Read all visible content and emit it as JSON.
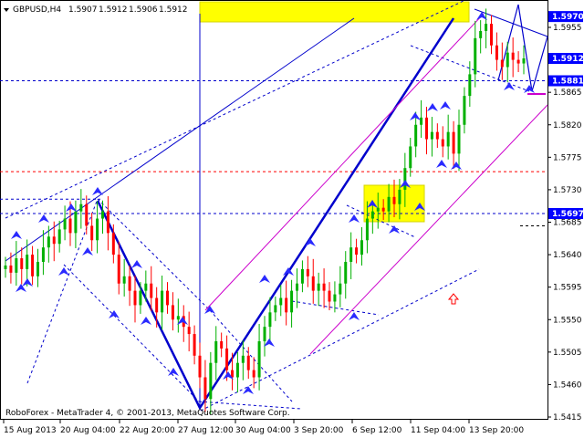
{
  "header": {
    "symbol": "GBPUSD,H4",
    "open": "1.5907",
    "high": "1.5912",
    "low": "1.5906",
    "close": "1.5912"
  },
  "copyright": "RoboForex - MetaTrader 4, © 2001-2013, MetaQuotes Software Corp.",
  "colors": {
    "bull": "#00b000",
    "bear": "#ff0000",
    "trend": "#0000cc",
    "channel": "#cc00cc",
    "level_red": "#ff0000",
    "highlight": "#ffff00",
    "price_box": "#0000ff",
    "fractal": "#2a2aff"
  },
  "chart_data": {
    "type": "candlestick",
    "ylim": [
      1.5405,
      1.599
    ],
    "y_ticks": [
      "1.5955",
      "1.5910",
      "1.5865",
      "1.5820",
      "1.5775",
      "1.5730",
      "1.5685",
      "1.5640",
      "1.5595",
      "1.5550",
      "1.5505",
      "1.5460",
      "1.5415"
    ],
    "x_labels": [
      "15 Aug 2013",
      "20 Aug 04:00",
      "22 Aug 20:00",
      "27 Aug 12:00",
      "30 Aug 04:00",
      "3 Sep 20:00",
      "6 Sep 12:00",
      "11 Sep 04:00",
      "13 Sep 20:00"
    ],
    "price_marks": [
      {
        "label": "1.5970",
        "value": 1.597
      },
      {
        "label": "1.5912",
        "value": 1.5912
      },
      {
        "label": "1.5881",
        "value": 1.5881
      },
      {
        "label": "1.5697",
        "value": 1.5697
      }
    ],
    "horizontal_levels": [
      {
        "value": 1.5881,
        "style": "dashed-blue"
      },
      {
        "value": 1.5697,
        "style": "dashed-blue"
      },
      {
        "value": 1.5717,
        "style": "dashed-blue"
      },
      {
        "value": 1.5755,
        "style": "dashed-red"
      },
      {
        "value": 1.568,
        "style": "dashed-black"
      }
    ],
    "candle_closes": [
      1.5625,
      1.5615,
      1.5635,
      1.562,
      1.564,
      1.561,
      1.563,
      1.565,
      1.5665,
      1.5655,
      1.5675,
      1.569,
      1.567,
      1.57,
      1.571,
      1.568,
      1.566,
      1.569,
      1.57,
      1.567,
      1.564,
      1.56,
      1.561,
      1.559,
      1.557,
      1.559,
      1.56,
      1.558,
      1.556,
      1.559,
      1.557,
      1.555,
      1.5555,
      1.554,
      1.553,
      1.55,
      1.547,
      1.544,
      1.549,
      1.552,
      1.551,
      1.548,
      1.547,
      1.549,
      1.55,
      1.548,
      1.547,
      1.552,
      1.554,
      1.556,
      1.557,
      1.558,
      1.556,
      1.559,
      1.56,
      1.562,
      1.561,
      1.559,
      1.56,
      1.559,
      1.5575,
      1.5585,
      1.56,
      1.563,
      1.565,
      1.564,
      1.566,
      1.569,
      1.57,
      1.5705,
      1.57,
      1.572,
      1.571,
      1.573,
      1.576,
      1.579,
      1.582,
      1.583,
      1.58,
      1.581,
      1.58,
      1.579,
      1.581,
      1.578,
      1.582,
      1.586,
      1.589,
      1.594,
      1.595,
      1.596,
      1.593,
      1.591,
      1.59,
      1.592,
      1.591,
      1.5905,
      1.5912
    ]
  }
}
